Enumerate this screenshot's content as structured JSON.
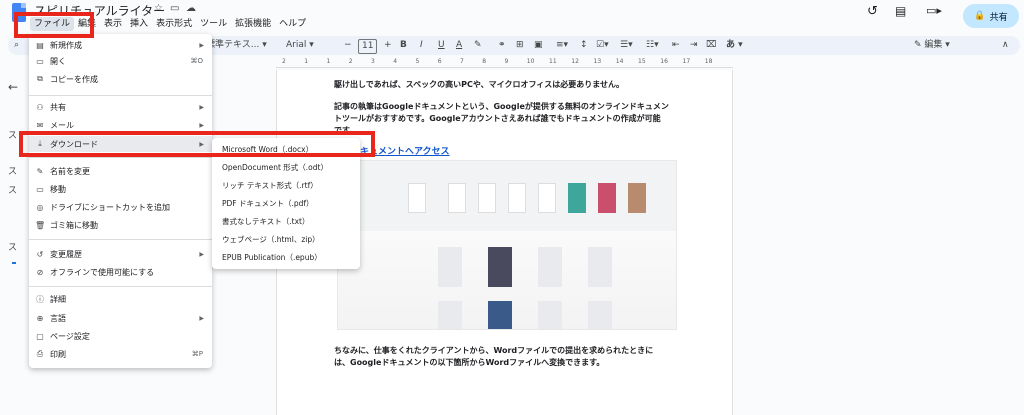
{
  "app": {
    "doc_title": "スピリチュアルライター",
    "icons": [
      "star-icon",
      "move-to-folder-icon",
      "cloud-saved-icon"
    ]
  },
  "menubar": [
    "ファイル",
    "編集",
    "表示",
    "挿入",
    "表示形式",
    "ツール",
    "拡張機能",
    "ヘルプ"
  ],
  "top_right": {
    "share_label": "共有",
    "icons": [
      "history-icon",
      "comment-icon",
      "meet-icon"
    ]
  },
  "toolbar": {
    "style_select": "標準テキス...",
    "font_select": "Arial",
    "font_size": "11",
    "minus": "−",
    "plus": "+",
    "bold": "B",
    "italic": "I",
    "underline": "U",
    "text_color": "A",
    "input_tools": "あ",
    "mode_label": "編集"
  },
  "ruler": [
    "2",
    "1",
    "1",
    "2",
    "3",
    "4",
    "5",
    "6",
    "7",
    "8",
    "9",
    "10",
    "11",
    "12",
    "13",
    "14",
    "15",
    "16",
    "17",
    "18"
  ],
  "file_menu": {
    "items": [
      {
        "icon": "new-doc-icon",
        "glyph": "▤",
        "label": "新規作成",
        "submenu": true
      },
      {
        "icon": "open-folder-icon",
        "glyph": "▭",
        "label": "開く",
        "shortcut": "⌘O"
      },
      {
        "icon": "copy-icon",
        "glyph": "⧉",
        "label": "コピーを作成"
      },
      {
        "icon": "share-person-icon",
        "glyph": "⚇",
        "label": "共有",
        "submenu": true
      },
      {
        "icon": "mail-icon",
        "glyph": "✉",
        "label": "メール",
        "submenu": true
      },
      {
        "icon": "download-icon",
        "glyph": "⤓",
        "label": "ダウンロード",
        "submenu": true
      },
      {
        "icon": "rename-icon",
        "glyph": "✎",
        "label": "名前を変更"
      },
      {
        "icon": "move-folder-icon",
        "glyph": "▭",
        "label": "移動"
      },
      {
        "icon": "drive-shortcut-icon",
        "glyph": "◎",
        "label": "ドライブにショートカットを追加"
      },
      {
        "icon": "trash-icon",
        "glyph": "🗑",
        "label": "ゴミ箱に移動"
      },
      {
        "icon": "version-history-icon",
        "glyph": "↺",
        "label": "変更履歴",
        "submenu": true
      },
      {
        "icon": "offline-icon",
        "glyph": "⊘",
        "label": "オフラインで使用可能にする"
      },
      {
        "icon": "info-icon",
        "glyph": "ⓘ",
        "label": "詳細"
      },
      {
        "icon": "language-icon",
        "glyph": "⊕",
        "label": "言語",
        "submenu": true
      },
      {
        "icon": "page-setup-icon",
        "glyph": "▢",
        "label": "ページ設定"
      },
      {
        "icon": "print-icon",
        "glyph": "⎙",
        "label": "印刷",
        "shortcut": "⌘P"
      }
    ]
  },
  "download_submenu": [
    "Microsoft Word（.docx）",
    "OpenDocument 形式（.odt）",
    "リッチ テキスト形式（.rtf）",
    "PDF ドキュメント（.pdf）",
    "書式なしテキスト（.txt）",
    "ウェブページ（.html、zip）",
    "EPUB Publication（.epub）"
  ],
  "document": {
    "para1": "駆け出しであれば、スペックの高いPCや、マイクロオフィスは必要ありません。",
    "para2_line1": "記事の執筆はGoogleドキュメントという、Googleが提供する無料のオンラインドキュメン",
    "para2_line2": "トツールがおすすめです。Googleアカウントさえあれば誰でもドキュメントの作成が可能",
    "para2_line3": "です。",
    "link_heading": "ドキュメントへアクセス",
    "para3_line1": "ちなみに、仕事をくれたクライアントから、Wordファイルでの提出を求められたときに",
    "para3_line2": "は、Googleドキュメントの以下箇所からWordファイルへ変換できます。"
  },
  "outline_stub": [
    "ス",
    "ス",
    "ス",
    "ス"
  ],
  "colors": {
    "highlight_red": "#e8261c",
    "share_bg": "#c2e7ff",
    "link": "#1155cc"
  }
}
